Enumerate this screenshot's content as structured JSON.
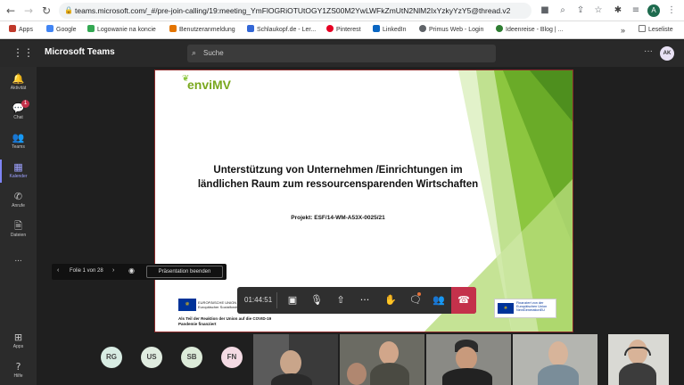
{
  "browser": {
    "url": "teams.microsoft.com/_#/pre-join-calling/19:meeting_YmFlOGRiOTUtOGY1ZS00M2YwLWFkZmUtN2NlM2IxYzkyYzY5@thread.v2",
    "profile_initial": "A",
    "bookmarks": [
      {
        "label": "Apps",
        "color": "#e8453c"
      },
      {
        "label": "Google",
        "color": "#4285f4"
      },
      {
        "label": "Logowanie na koncie",
        "color": "#34a853"
      },
      {
        "label": "Benutzeranmeldung",
        "color": "#e37400"
      },
      {
        "label": "Schlaukopf.de - Ler...",
        "color": "#3367d6"
      },
      {
        "label": "Pinterest",
        "color": "#e60023"
      },
      {
        "label": "LinkedIn",
        "color": "#0a66c2"
      },
      {
        "label": "Primus Web - Login",
        "color": "#5f6368"
      },
      {
        "label": "Ideenreise - Blog | ...",
        "color": "#2e7d32"
      }
    ],
    "reading_list": "Leseliste"
  },
  "teams": {
    "title": "Microsoft Teams",
    "search_placeholder": "Suche",
    "avatar_initials": "AK",
    "rail": [
      {
        "label": "Aktivität",
        "icon": "bell-icon",
        "glyph": "🔔"
      },
      {
        "label": "Chat",
        "icon": "chat-icon",
        "glyph": "💬",
        "badge": "1"
      },
      {
        "label": "Teams",
        "icon": "teams-icon",
        "glyph": "👥"
      },
      {
        "label": "Kalender",
        "icon": "calendar-icon",
        "glyph": "▦"
      },
      {
        "label": "Anrufe",
        "icon": "phone-icon",
        "glyph": "✆"
      },
      {
        "label": "Dateien",
        "icon": "file-icon",
        "glyph": "🗎"
      },
      {
        "label": "...",
        "icon": "more-icon",
        "glyph": ""
      }
    ],
    "rail_bottom": [
      {
        "label": "Apps",
        "icon": "apps-icon",
        "glyph": "⊞"
      },
      {
        "label": "Hilfe",
        "icon": "help-icon",
        "glyph": "?"
      }
    ]
  },
  "slide": {
    "logo": "enviMV",
    "title": "Unterstützung von Unternehmen /Einrichtungen im ländlichen Raum zum ressourcensparenden Wirtschaften",
    "project": "Projekt: ESF/14-WM-A53X-0025/21",
    "eu_label_left": "EUROPÄISCHE UNION\nEuropäischer Sozialfonds",
    "funding_note": "Als Teil der Reaktion der Union auf die COVID-19 Pandemie finanziert",
    "eu_label_right": "Finanziert von der Europäischen Union\nNextGenerationEU"
  },
  "presentation": {
    "slide_counter": "Folie 1 von 28",
    "end_label": "Präsentation beenden"
  },
  "call": {
    "timer": "01:44:51"
  },
  "participants": {
    "avatars": [
      {
        "initials": "RG",
        "color": "#d8ece3"
      },
      {
        "initials": "US",
        "color": "#e0ece0"
      },
      {
        "initials": "SB",
        "color": "#dcebd9"
      },
      {
        "initials": "FN",
        "color": "#f4dbe4"
      }
    ]
  }
}
